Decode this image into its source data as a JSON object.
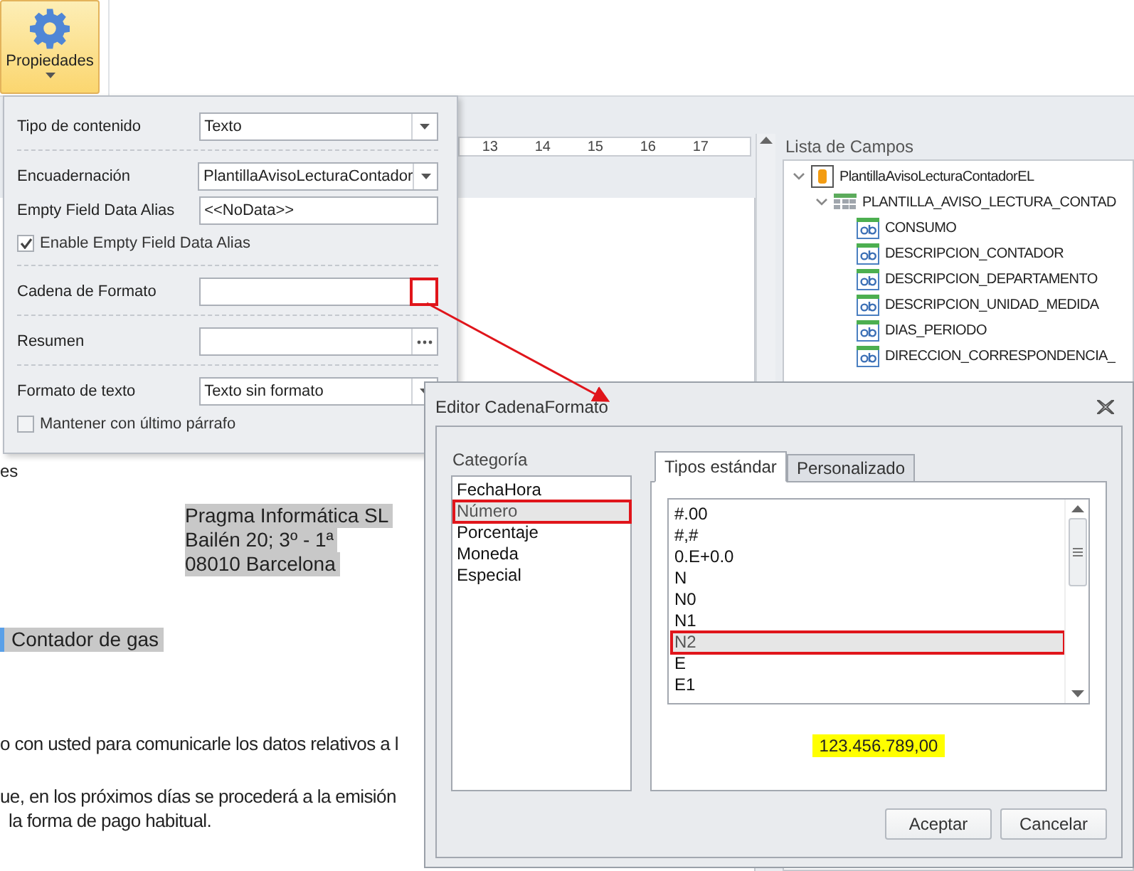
{
  "ribbon": {
    "button": {
      "label": "Propiedades",
      "pressed": true
    }
  },
  "properties_popup": {
    "groups": [
      [
        {
          "kind": "dropdown",
          "label": "Tipo de contenido",
          "value": "Texto"
        }
      ],
      [
        {
          "kind": "dropdown",
          "label": "Encuadernación",
          "value": "PlantillaAvisoLecturaContador"
        },
        {
          "kind": "text",
          "label": "Empty Field Data Alias",
          "value": "<<NoData>>"
        },
        {
          "kind": "checkbox",
          "label": "Enable Empty Field Data Alias",
          "checked": true
        }
      ],
      [
        {
          "kind": "picker",
          "label": "Cadena de Formato",
          "highlighted": true
        }
      ],
      [
        {
          "kind": "ellipsis",
          "label": "Resumen"
        }
      ],
      [
        {
          "kind": "dropdown",
          "label": "Formato de texto",
          "value": "Texto sin formato"
        },
        {
          "kind": "checkbox",
          "label": "Mantener con último párrafo",
          "checked": false
        }
      ]
    ]
  },
  "document": {
    "ruler": [
      "13",
      "14",
      "15",
      "16",
      "17"
    ],
    "lines": [
      {
        "kind": "plain",
        "text": "es"
      },
      {
        "kind": "address",
        "text": "Pragma Informática SL"
      },
      {
        "kind": "address",
        "text": "Bailén 20; 3º - 1ª"
      },
      {
        "kind": "address",
        "text": "08010 Barcelona"
      },
      {
        "kind": "field",
        "text": "Contador de gas"
      },
      {
        "kind": "paragraph",
        "text": "o con usted para comunicarle los datos relativos a l"
      },
      {
        "kind": "paragraph",
        "text": "ue, en los próximos días se procederá a la emisión"
      },
      {
        "kind": "continuation",
        "text": "la forma de pago habitual."
      }
    ]
  },
  "field_list": {
    "title": "Lista de Campos",
    "tree": [
      {
        "label": "PlantillaAvisoLecturaContadorEL",
        "kind": "datasource",
        "expanded": true,
        "children": [
          {
            "label": "PLANTILLA_AVISO_LECTURA_CONTAD",
            "kind": "table",
            "expanded": true,
            "children": [
              {
                "label": "CONSUMO",
                "kind": "field"
              },
              {
                "label": "DESCRIPCION_CONTADOR",
                "kind": "field"
              },
              {
                "label": "DESCRIPCION_DEPARTAMENTO",
                "kind": "field"
              },
              {
                "label": "DESCRIPCION_UNIDAD_MEDIDA",
                "kind": "field"
              },
              {
                "label": "DIAS_PERIODO",
                "kind": "field"
              },
              {
                "label": "DIRECCION_CORRESPONDENCIA_",
                "kind": "field"
              }
            ]
          }
        ]
      }
    ]
  },
  "dialog": {
    "title": "Editor CadenaFormato",
    "category_label": "Categoría",
    "categories": [
      {
        "label": "FechaHora",
        "selected": false
      },
      {
        "label": "Número",
        "selected": true
      },
      {
        "label": "Porcentaje",
        "selected": false
      },
      {
        "label": "Moneda",
        "selected": false
      },
      {
        "label": "Especial",
        "selected": false
      }
    ],
    "tabs": [
      {
        "label": "Tipos estándar",
        "selected": true
      },
      {
        "label": "Personalizado",
        "selected": false
      }
    ],
    "formats": [
      {
        "label": "#.00",
        "selected": false
      },
      {
        "label": "#,#",
        "selected": false
      },
      {
        "label": "0.E+0.0",
        "selected": false
      },
      {
        "label": "N",
        "selected": false
      },
      {
        "label": "N0",
        "selected": false
      },
      {
        "label": "N1",
        "selected": false
      },
      {
        "label": "N2",
        "selected": true
      },
      {
        "label": "E",
        "selected": false
      },
      {
        "label": "E1",
        "selected": false
      }
    ],
    "preview": "123.456.789,00",
    "buttons": [
      "Aceptar",
      "Cancelar"
    ]
  }
}
